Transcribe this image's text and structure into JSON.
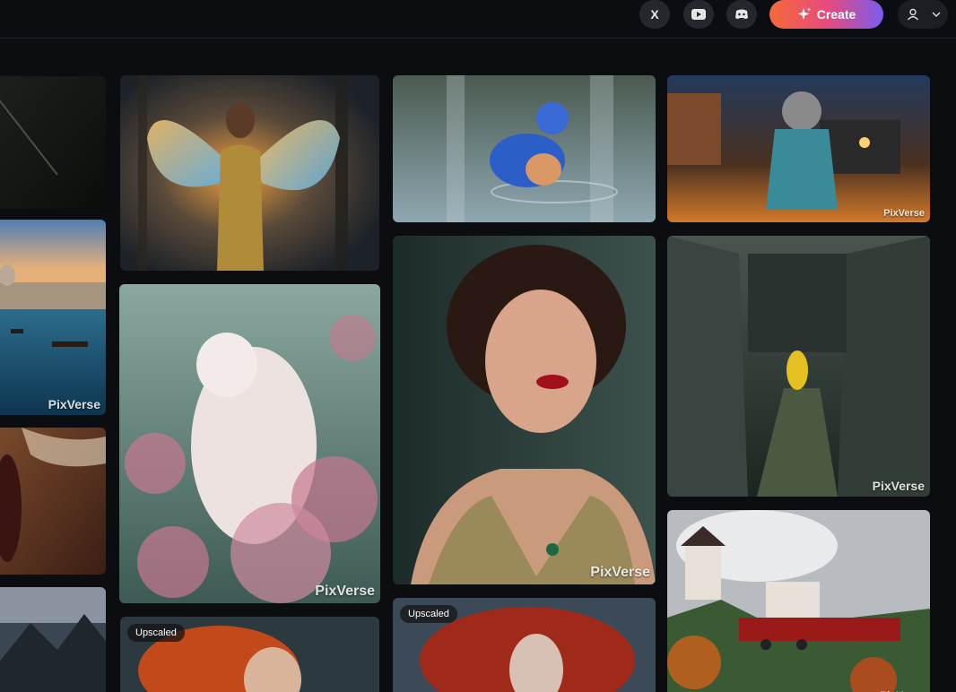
{
  "header": {
    "x_icon": "X",
    "create_label": "Create",
    "icons": [
      "x-icon",
      "youtube-icon",
      "discord-icon",
      "sparkle-icon",
      "user-icon",
      "chevron-down-icon"
    ]
  },
  "gallery": {
    "watermark": "PixVerse",
    "badge_label": "Upscaled",
    "accent": "#f56a3a"
  }
}
